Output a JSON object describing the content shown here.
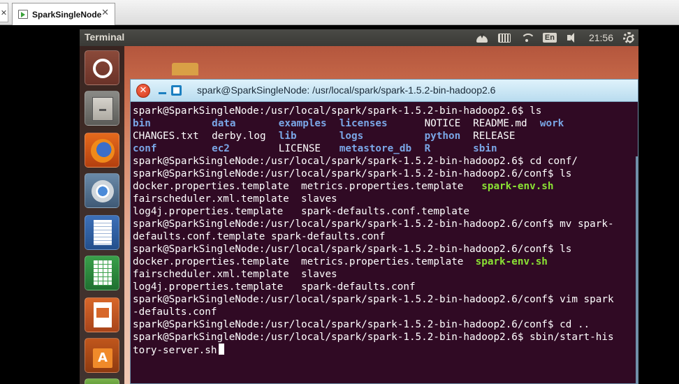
{
  "host_tab": {
    "label": "SparkSingleNode",
    "close": "✕",
    "left_close": "✕"
  },
  "panel": {
    "title": "Terminal",
    "lang": "En",
    "clock": "21:56"
  },
  "launcher": {
    "software_glyph": "A"
  },
  "window": {
    "title": "spark@SparkSingleNode: /usr/local/spark/spark-1.5.2-bin-hadoop2.6",
    "close_glyph": "✕"
  },
  "terminal": {
    "lines": [
      [
        {
          "t": "spark@SparkSingleNode:/usr/local/spark/spark-1.5.2-bin-hadoop2.6$ ls",
          "c": "white"
        }
      ],
      [
        {
          "t": "bin",
          "c": "blue",
          "w": 13
        },
        {
          "t": "data",
          "c": "blue",
          "w": 11
        },
        {
          "t": "examples",
          "c": "blue",
          "w": 10
        },
        {
          "t": "licenses",
          "c": "blue",
          "w": 14
        },
        {
          "t": "NOTICE",
          "c": "white",
          "w": 8
        },
        {
          "t": "README.md",
          "c": "white",
          "w": 11
        },
        {
          "t": "work",
          "c": "blue"
        }
      ],
      [
        {
          "t": "CHANGES.txt",
          "c": "white",
          "w": 13
        },
        {
          "t": "derby.log",
          "c": "white",
          "w": 11
        },
        {
          "t": "lib",
          "c": "blue",
          "w": 10
        },
        {
          "t": "logs",
          "c": "blue",
          "w": 14
        },
        {
          "t": "python",
          "c": "blue",
          "w": 8
        },
        {
          "t": "RELEASE",
          "c": "white"
        }
      ],
      [
        {
          "t": "conf",
          "c": "blue",
          "w": 13
        },
        {
          "t": "ec2",
          "c": "blue",
          "w": 11
        },
        {
          "t": "LICENSE",
          "c": "white",
          "w": 10
        },
        {
          "t": "metastore_db",
          "c": "blue",
          "w": 14
        },
        {
          "t": "R",
          "c": "blue",
          "w": 8
        },
        {
          "t": "sbin",
          "c": "blue"
        }
      ],
      [
        {
          "t": "spark@SparkSingleNode:/usr/local/spark/spark-1.5.2-bin-hadoop2.6$ cd conf/",
          "c": "white"
        }
      ],
      [
        {
          "t": "spark@SparkSingleNode:/usr/local/spark/spark-1.5.2-bin-hadoop2.6/conf$ ls",
          "c": "white"
        }
      ],
      [
        {
          "t": "docker.properties.template  metrics.properties.template   ",
          "c": "white"
        },
        {
          "t": "spark-env.sh",
          "c": "green"
        }
      ],
      [
        {
          "t": "fairscheduler.xml.template  slaves",
          "c": "white"
        }
      ],
      [
        {
          "t": "log4j.properties.template   spark-defaults.conf.template",
          "c": "white"
        }
      ],
      [
        {
          "t": "spark@SparkSingleNode:/usr/local/spark/spark-1.5.2-bin-hadoop2.6/conf$ mv spark-",
          "c": "white"
        }
      ],
      [
        {
          "t": "defaults.conf.template spark-defaults.conf",
          "c": "white"
        }
      ],
      [
        {
          "t": "spark@SparkSingleNode:/usr/local/spark/spark-1.5.2-bin-hadoop2.6/conf$ ls",
          "c": "white"
        }
      ],
      [
        {
          "t": "docker.properties.template  metrics.properties.template  ",
          "c": "white"
        },
        {
          "t": "spark-env.sh",
          "c": "green"
        }
      ],
      [
        {
          "t": "fairscheduler.xml.template  slaves",
          "c": "white"
        }
      ],
      [
        {
          "t": "log4j.properties.template   spark-defaults.conf",
          "c": "white"
        }
      ],
      [
        {
          "t": "spark@SparkSingleNode:/usr/local/spark/spark-1.5.2-bin-hadoop2.6/conf$ vim spark",
          "c": "white"
        }
      ],
      [
        {
          "t": "-defaults.conf",
          "c": "white"
        }
      ],
      [
        {
          "t": "spark@SparkSingleNode:/usr/local/spark/spark-1.5.2-bin-hadoop2.6/conf$ cd ..",
          "c": "white"
        }
      ],
      [
        {
          "t": "spark@SparkSingleNode:/usr/local/spark/spark-1.5.2-bin-hadoop2.6$ sbin/start-his",
          "c": "white"
        }
      ],
      [
        {
          "t": "tory-server.sh",
          "c": "white",
          "cursor": true
        }
      ]
    ]
  }
}
